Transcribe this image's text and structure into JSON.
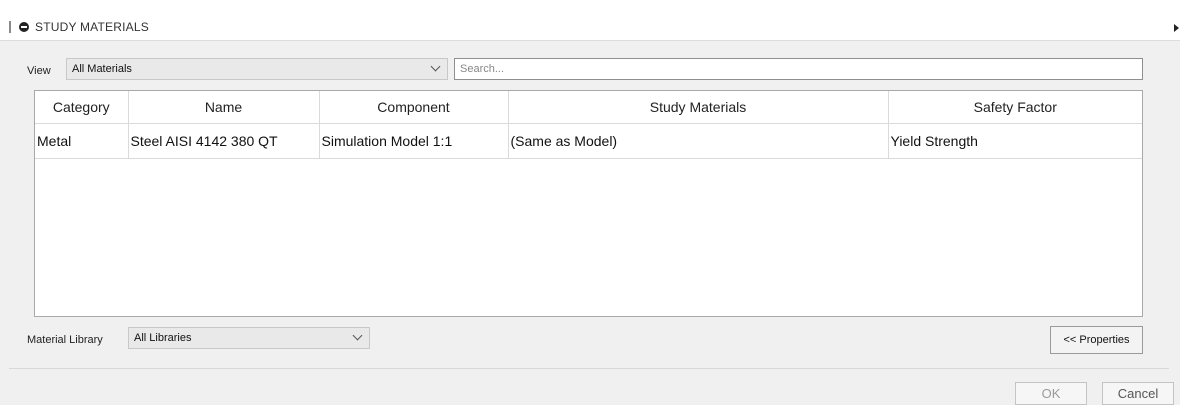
{
  "header": {
    "title": "STUDY MATERIALS",
    "collapse_icon": "minus-circle-icon",
    "expand_icon": "triangle-right-icon"
  },
  "filter": {
    "view_label": "View",
    "view_value": "All Materials",
    "search_placeholder": "Search..."
  },
  "table": {
    "columns": [
      "Category",
      "Name",
      "Component",
      "Study Materials",
      "Safety Factor"
    ],
    "rows": [
      [
        "Metal",
        "Steel AISI 4142 380 QT",
        "Simulation Model 1:1",
        "(Same as Model)",
        "Yield Strength"
      ]
    ]
  },
  "library": {
    "label": "Material Library",
    "value": "All Libraries"
  },
  "buttons": {
    "properties": "<< Properties",
    "ok": "OK",
    "cancel": "Cancel"
  }
}
